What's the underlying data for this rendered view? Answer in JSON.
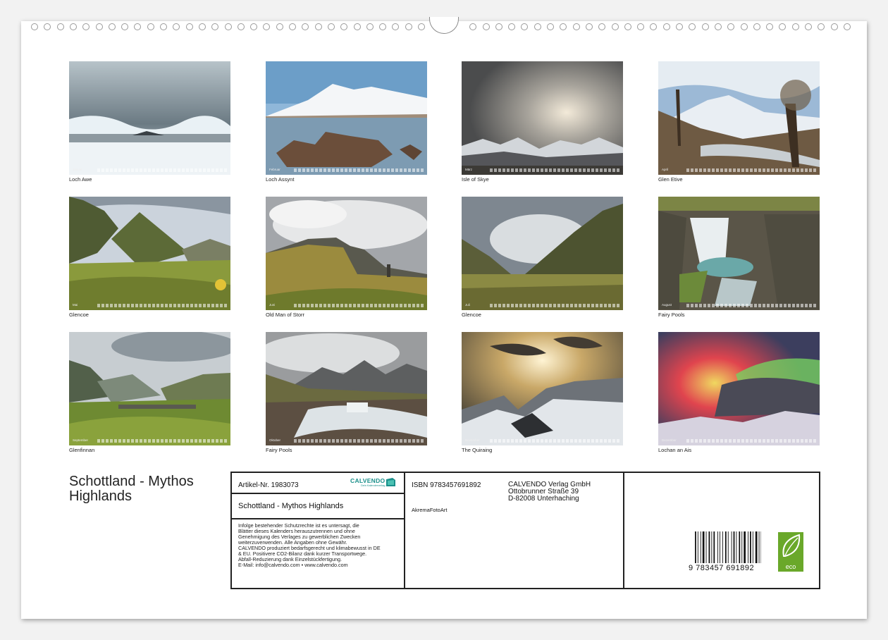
{
  "calendar": {
    "title": "Schottland - Mythos Highlands",
    "title_line1": "Schottland - Mythos",
    "title_line2": "Highlands"
  },
  "months": [
    {
      "caption": "Loch Awe",
      "month": "Januar"
    },
    {
      "caption": "Loch Assynt",
      "month": "Februar"
    },
    {
      "caption": "Isle of Skye",
      "month": "März"
    },
    {
      "caption": "Glen Etive",
      "month": "April"
    },
    {
      "caption": "Glencoe",
      "month": "Mai"
    },
    {
      "caption": "Old Man of Storr",
      "month": "Juni"
    },
    {
      "caption": "Glencoe",
      "month": "Juli"
    },
    {
      "caption": "Fairy Pools",
      "month": "August"
    },
    {
      "caption": "Glenfinnan",
      "month": "September"
    },
    {
      "caption": "Fairy Pools",
      "month": "Oktober"
    },
    {
      "caption": "The Quiraing",
      "month": "November"
    },
    {
      "caption": "Lochan an Ais",
      "month": "Dezember"
    }
  ],
  "info": {
    "article": "Artikel-Nr. 1983073",
    "brand": "CALVENDO",
    "brand_tagline": "Dein Kalenderverlag",
    "product_title": "Schottland - Mythos Highlands",
    "legal": [
      "Infolge bestehender Schutzrechte ist es untersagt, die",
      "Blätter dieses Kalenders herauszutrennen und ohne",
      "Genehmigung des Verlages zu gewerblichen Zwecken",
      "weiterzuverwenden. Alle Angaben ohne Gewähr.",
      "CALVENDO produziert bedarfsgerecht und klimabewusst in DE",
      "& EU. Positivere CO2-Bilanz dank kurzer Transportwege.",
      "Abfall-Reduzierung dank Einzelstückfertigung.",
      "E-Mail: info@calvendo.com • www.calvendo.com"
    ],
    "isbn": "ISBN 9783457691892",
    "author": "AkremaFotoArt",
    "publisher_name": "CALVENDO Verlag GmbH",
    "publisher_street": "Ottobrunner Straße 39",
    "publisher_city": "D-82008 Unterhaching",
    "barcode_digits": "9 783457 691892",
    "eco_label": "eco"
  },
  "colors": {
    "accent": "#6aa82a",
    "brand_teal": "#1a8f8a",
    "border": "#222222"
  }
}
